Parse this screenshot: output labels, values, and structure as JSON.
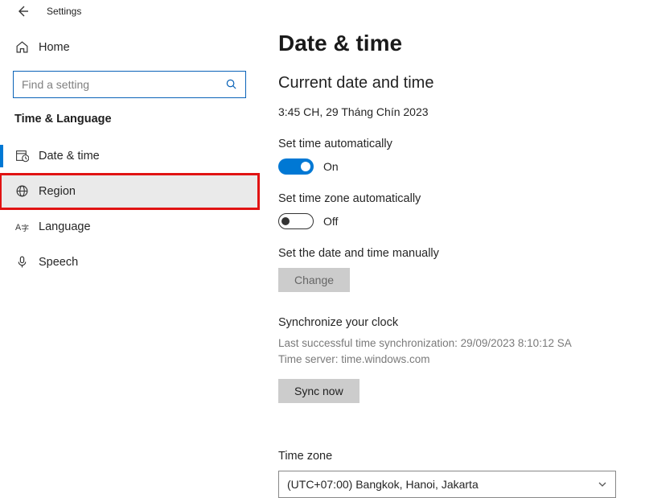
{
  "titlebar": {
    "title": "Settings"
  },
  "sidebar": {
    "home_label": "Home",
    "search_placeholder": "Find a setting",
    "section_label": "Time & Language",
    "items": [
      {
        "label": "Date & time"
      },
      {
        "label": "Region"
      },
      {
        "label": "Language"
      },
      {
        "label": "Speech"
      }
    ]
  },
  "content": {
    "page_title": "Date & time",
    "subtitle": "Current date and time",
    "current_datetime": "3:45 CH, 29 Tháng Chín 2023",
    "set_time_auto_label": "Set time automatically",
    "set_time_auto_state": "On",
    "set_tz_auto_label": "Set time zone automatically",
    "set_tz_auto_state": "Off",
    "manual_label": "Set the date and time manually",
    "change_button": "Change",
    "sync_title": "Synchronize your clock",
    "sync_last": "Last successful time synchronization: 29/09/2023 8:10:12 SA",
    "sync_server": "Time server: time.windows.com",
    "sync_button": "Sync now",
    "tz_label": "Time zone",
    "tz_value": "(UTC+07:00) Bangkok, Hanoi, Jakarta"
  }
}
